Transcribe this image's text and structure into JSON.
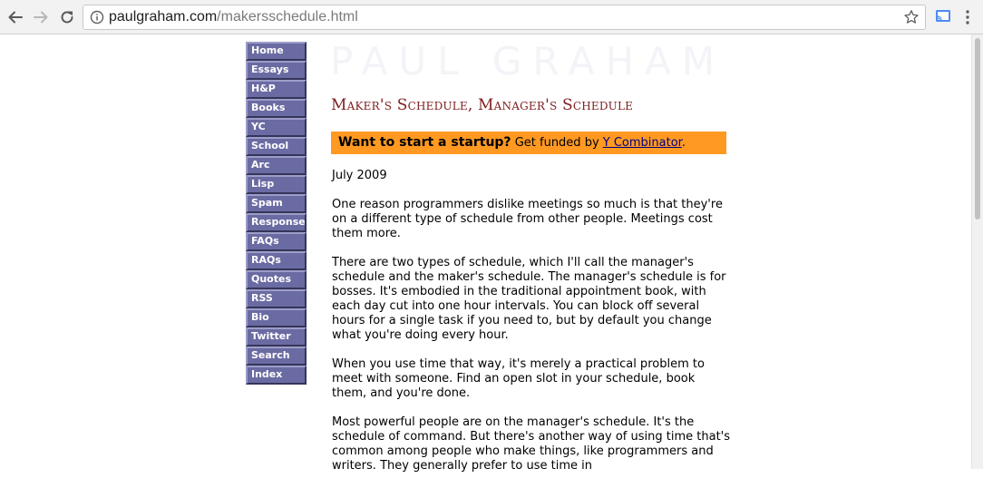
{
  "browser": {
    "url_host": "paulgraham.com",
    "url_path": "/makersschedule.html"
  },
  "site": {
    "logo_text": "PAUL GRAHAM"
  },
  "sidebar": {
    "items": [
      {
        "label": "Home"
      },
      {
        "label": "Essays"
      },
      {
        "label": "H&P"
      },
      {
        "label": "Books"
      },
      {
        "label": "YC"
      },
      {
        "label": "School"
      },
      {
        "label": "Arc"
      },
      {
        "label": "Lisp"
      },
      {
        "label": "Spam"
      },
      {
        "label": "Responses"
      },
      {
        "label": "FAQs"
      },
      {
        "label": "RAQs"
      },
      {
        "label": "Quotes"
      },
      {
        "label": "RSS"
      },
      {
        "label": "Bio"
      },
      {
        "label": "Twitter"
      },
      {
        "label": "Search"
      },
      {
        "label": "Index"
      }
    ]
  },
  "article": {
    "title": "Maker's Schedule, Manager's Schedule",
    "banner": {
      "bold_text": "Want to start a startup?",
      "text": "Get funded by",
      "link_text": "Y Combinator",
      "suffix": "."
    },
    "date": "July 2009",
    "paragraphs": [
      "One reason programmers dislike meetings so much is that they're on a different type of schedule from other people. Meetings cost them more.",
      "There are two types of schedule, which I'll call the manager's schedule and the maker's schedule. The manager's schedule is for bosses. It's embodied in the traditional appointment book, with each day cut into one hour intervals. You can block off several hours for a single task if you need to, but by default you change what you're doing every hour.",
      "When you use time that way, it's merely a practical problem to meet with someone. Find an open slot in your schedule, book them, and you're done.",
      "Most powerful people are on the manager's schedule. It's the schedule of command. But there's another way of using time that's common among people who make things, like programmers and writers. They generally prefer to use time in"
    ]
  },
  "colors": {
    "nav_bg": "#6b6ba3",
    "title": "#7d1d1d",
    "banner_bg": "#ff9922",
    "link": "#000080"
  }
}
